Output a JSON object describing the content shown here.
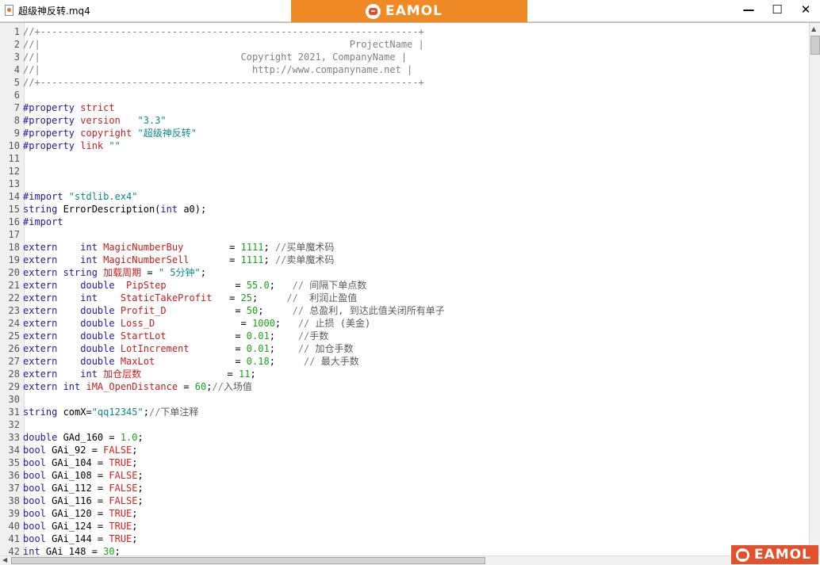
{
  "window": {
    "title": "超级神反转.mq4",
    "brand": "EAMOL",
    "controls": {
      "minimize": "—",
      "maximize": "☐",
      "close": "✕"
    }
  },
  "watermark": {
    "text": "EAMOL"
  },
  "colors": {
    "brand_orange": "#f08a24",
    "watermark_red": "#e2512b",
    "keyword": "#1a1aa6",
    "identifier": "#c81e1e",
    "string": "#0a8a8a",
    "number": "#19a319",
    "comment": "#808080"
  },
  "code_lines": [
    {
      "n": "1",
      "tokens": [
        [
          "comment",
          "//+------------------------------------------------------------------+"
        ]
      ]
    },
    {
      "n": "2",
      "tokens": [
        [
          "comment",
          "//|                                                      ProjectName |"
        ]
      ]
    },
    {
      "n": "3",
      "tokens": [
        [
          "comment",
          "//|                                   Copyright 2021, CompanyName |"
        ]
      ]
    },
    {
      "n": "4",
      "tokens": [
        [
          "comment",
          "//|                                     http://www.companyname.net |"
        ]
      ]
    },
    {
      "n": "5",
      "tokens": [
        [
          "comment",
          "//+------------------------------------------------------------------+"
        ]
      ]
    },
    {
      "n": "6",
      "tokens": []
    },
    {
      "n": "7",
      "tokens": [
        [
          "key",
          "#property "
        ],
        [
          "name",
          "strict"
        ]
      ]
    },
    {
      "n": "8",
      "tokens": [
        [
          "key",
          "#property "
        ],
        [
          "name",
          "version"
        ],
        [
          "txt",
          "   "
        ],
        [
          "str",
          "\"3.3\""
        ]
      ]
    },
    {
      "n": "9",
      "tokens": [
        [
          "key",
          "#property "
        ],
        [
          "name",
          "copyright "
        ],
        [
          "str",
          "\"超级神反转\""
        ]
      ]
    },
    {
      "n": "10",
      "tokens": [
        [
          "key",
          "#property "
        ],
        [
          "name",
          "link "
        ],
        [
          "str",
          "\"\""
        ]
      ]
    },
    {
      "n": "11",
      "tokens": []
    },
    {
      "n": "12",
      "tokens": []
    },
    {
      "n": "13",
      "tokens": []
    },
    {
      "n": "14",
      "tokens": [
        [
          "key",
          "#import "
        ],
        [
          "str",
          "\"stdlib.ex4\""
        ]
      ]
    },
    {
      "n": "15",
      "tokens": [
        [
          "key",
          "string "
        ],
        [
          "txt",
          "ErrorDescription("
        ],
        [
          "key",
          "int "
        ],
        [
          "txt",
          "a0);"
        ]
      ]
    },
    {
      "n": "16",
      "tokens": [
        [
          "key",
          "#import"
        ]
      ]
    },
    {
      "n": "17",
      "tokens": []
    },
    {
      "n": "18",
      "tokens": [
        [
          "key",
          "extern    int "
        ],
        [
          "name",
          "MagicNumberBuy"
        ],
        [
          "txt",
          "        = "
        ],
        [
          "num",
          "1111"
        ],
        [
          "txt",
          "; "
        ],
        [
          "comment",
          "//"
        ],
        [
          "cn",
          "买单魔术码"
        ]
      ]
    },
    {
      "n": "19",
      "tokens": [
        [
          "key",
          "extern    int "
        ],
        [
          "name",
          "MagicNumberSell"
        ],
        [
          "txt",
          "       = "
        ],
        [
          "num",
          "1111"
        ],
        [
          "txt",
          "; "
        ],
        [
          "comment",
          "//"
        ],
        [
          "cn",
          "卖单魔术码"
        ]
      ]
    },
    {
      "n": "20",
      "tokens": [
        [
          "key",
          "extern string "
        ],
        [
          "name",
          "加载周期"
        ],
        [
          "txt",
          " = "
        ],
        [
          "str",
          "\" 5分钟\""
        ],
        [
          "txt",
          ";"
        ]
      ]
    },
    {
      "n": "21",
      "tokens": [
        [
          "key",
          "extern    double  "
        ],
        [
          "name",
          "PipStep"
        ],
        [
          "txt",
          "            = "
        ],
        [
          "num",
          "55.0"
        ],
        [
          "txt",
          ";   "
        ],
        [
          "comment",
          "// "
        ],
        [
          "cn",
          "间隔下单点数"
        ]
      ]
    },
    {
      "n": "22",
      "tokens": [
        [
          "key",
          "extern    int    "
        ],
        [
          "name",
          "StaticTakeProfit"
        ],
        [
          "txt",
          "   = "
        ],
        [
          "num",
          "25"
        ],
        [
          "txt",
          ";     "
        ],
        [
          "comment",
          "//  "
        ],
        [
          "cn",
          "利润止盈值"
        ]
      ]
    },
    {
      "n": "23",
      "tokens": [
        [
          "key",
          "extern    double "
        ],
        [
          "name",
          "Profit_D"
        ],
        [
          "txt",
          "            = "
        ],
        [
          "num",
          "50"
        ],
        [
          "txt",
          ";     "
        ],
        [
          "comment",
          "// "
        ],
        [
          "cn",
          "总盈利, 到达此值关闭所有单子"
        ]
      ]
    },
    {
      "n": "24",
      "tokens": [
        [
          "key",
          "extern    double "
        ],
        [
          "name",
          "Loss_D"
        ],
        [
          "txt",
          "               = "
        ],
        [
          "num",
          "1000"
        ],
        [
          "txt",
          ";   "
        ],
        [
          "comment",
          "// "
        ],
        [
          "cn",
          "止损 (美金)"
        ]
      ]
    },
    {
      "n": "25",
      "tokens": [
        [
          "key",
          "extern    double "
        ],
        [
          "name",
          "StartLot"
        ],
        [
          "txt",
          "            = "
        ],
        [
          "num",
          "0.01"
        ],
        [
          "txt",
          ";    "
        ],
        [
          "comment",
          "//"
        ],
        [
          "cn",
          "手数"
        ]
      ]
    },
    {
      "n": "26",
      "tokens": [
        [
          "key",
          "extern    double "
        ],
        [
          "name",
          "LotIncrement"
        ],
        [
          "txt",
          "        = "
        ],
        [
          "num",
          "0.01"
        ],
        [
          "txt",
          ";    "
        ],
        [
          "comment",
          "// "
        ],
        [
          "cn",
          "加仓手数"
        ]
      ]
    },
    {
      "n": "27",
      "tokens": [
        [
          "key",
          "extern    double "
        ],
        [
          "name",
          "MaxLot"
        ],
        [
          "txt",
          "              = "
        ],
        [
          "num",
          "0.18"
        ],
        [
          "txt",
          ";     "
        ],
        [
          "comment",
          "// "
        ],
        [
          "cn",
          "最大手数"
        ]
      ]
    },
    {
      "n": "28",
      "tokens": [
        [
          "key",
          "extern    int "
        ],
        [
          "name",
          "加仓层数"
        ],
        [
          "txt",
          "               = "
        ],
        [
          "num",
          "11"
        ],
        [
          "txt",
          ";"
        ]
      ]
    },
    {
      "n": "29",
      "tokens": [
        [
          "key",
          "extern int "
        ],
        [
          "name",
          "iMA_OpenDistance"
        ],
        [
          "txt",
          " = "
        ],
        [
          "num",
          "60"
        ],
        [
          "txt",
          ";"
        ],
        [
          "comment",
          "//"
        ],
        [
          "cn",
          "入场值"
        ]
      ]
    },
    {
      "n": "30",
      "tokens": []
    },
    {
      "n": "31",
      "tokens": [
        [
          "key",
          "string "
        ],
        [
          "txt",
          "comX="
        ],
        [
          "str",
          "\"qq12345\""
        ],
        [
          "txt",
          ";"
        ],
        [
          "comment",
          "//"
        ],
        [
          "cn",
          "下单注释"
        ]
      ]
    },
    {
      "n": "32",
      "tokens": []
    },
    {
      "n": "33",
      "tokens": [
        [
          "key",
          "double "
        ],
        [
          "txt",
          "GAd_160 = "
        ],
        [
          "num",
          "1.0"
        ],
        [
          "txt",
          ";"
        ]
      ]
    },
    {
      "n": "34",
      "tokens": [
        [
          "key",
          "bool "
        ],
        [
          "txt",
          "GAi_92 = "
        ],
        [
          "bool",
          "FALSE"
        ],
        [
          "txt",
          ";"
        ]
      ]
    },
    {
      "n": "35",
      "tokens": [
        [
          "key",
          "bool "
        ],
        [
          "txt",
          "GAi_104 = "
        ],
        [
          "bool",
          "TRUE"
        ],
        [
          "txt",
          ";"
        ]
      ]
    },
    {
      "n": "36",
      "tokens": [
        [
          "key",
          "bool "
        ],
        [
          "txt",
          "GAi_108 = "
        ],
        [
          "bool",
          "FALSE"
        ],
        [
          "txt",
          ";"
        ]
      ]
    },
    {
      "n": "37",
      "tokens": [
        [
          "key",
          "bool "
        ],
        [
          "txt",
          "GAi_112 = "
        ],
        [
          "bool",
          "FALSE"
        ],
        [
          "txt",
          ";"
        ]
      ]
    },
    {
      "n": "38",
      "tokens": [
        [
          "key",
          "bool "
        ],
        [
          "txt",
          "GAi_116 = "
        ],
        [
          "bool",
          "FALSE"
        ],
        [
          "txt",
          ";"
        ]
      ]
    },
    {
      "n": "39",
      "tokens": [
        [
          "key",
          "bool "
        ],
        [
          "txt",
          "GAi_120 = "
        ],
        [
          "bool",
          "TRUE"
        ],
        [
          "txt",
          ";"
        ]
      ]
    },
    {
      "n": "40",
      "tokens": [
        [
          "key",
          "bool "
        ],
        [
          "txt",
          "GAi_124 = "
        ],
        [
          "bool",
          "TRUE"
        ],
        [
          "txt",
          ";"
        ]
      ]
    },
    {
      "n": "41",
      "tokens": [
        [
          "key",
          "bool "
        ],
        [
          "txt",
          "GAi_144 = "
        ],
        [
          "bool",
          "TRUE"
        ],
        [
          "txt",
          ";"
        ]
      ]
    },
    {
      "n": "42",
      "tokens": [
        [
          "key",
          "int "
        ],
        [
          "txt",
          "GAi_148 = "
        ],
        [
          "num",
          "30"
        ],
        [
          "txt",
          ";"
        ]
      ]
    }
  ]
}
